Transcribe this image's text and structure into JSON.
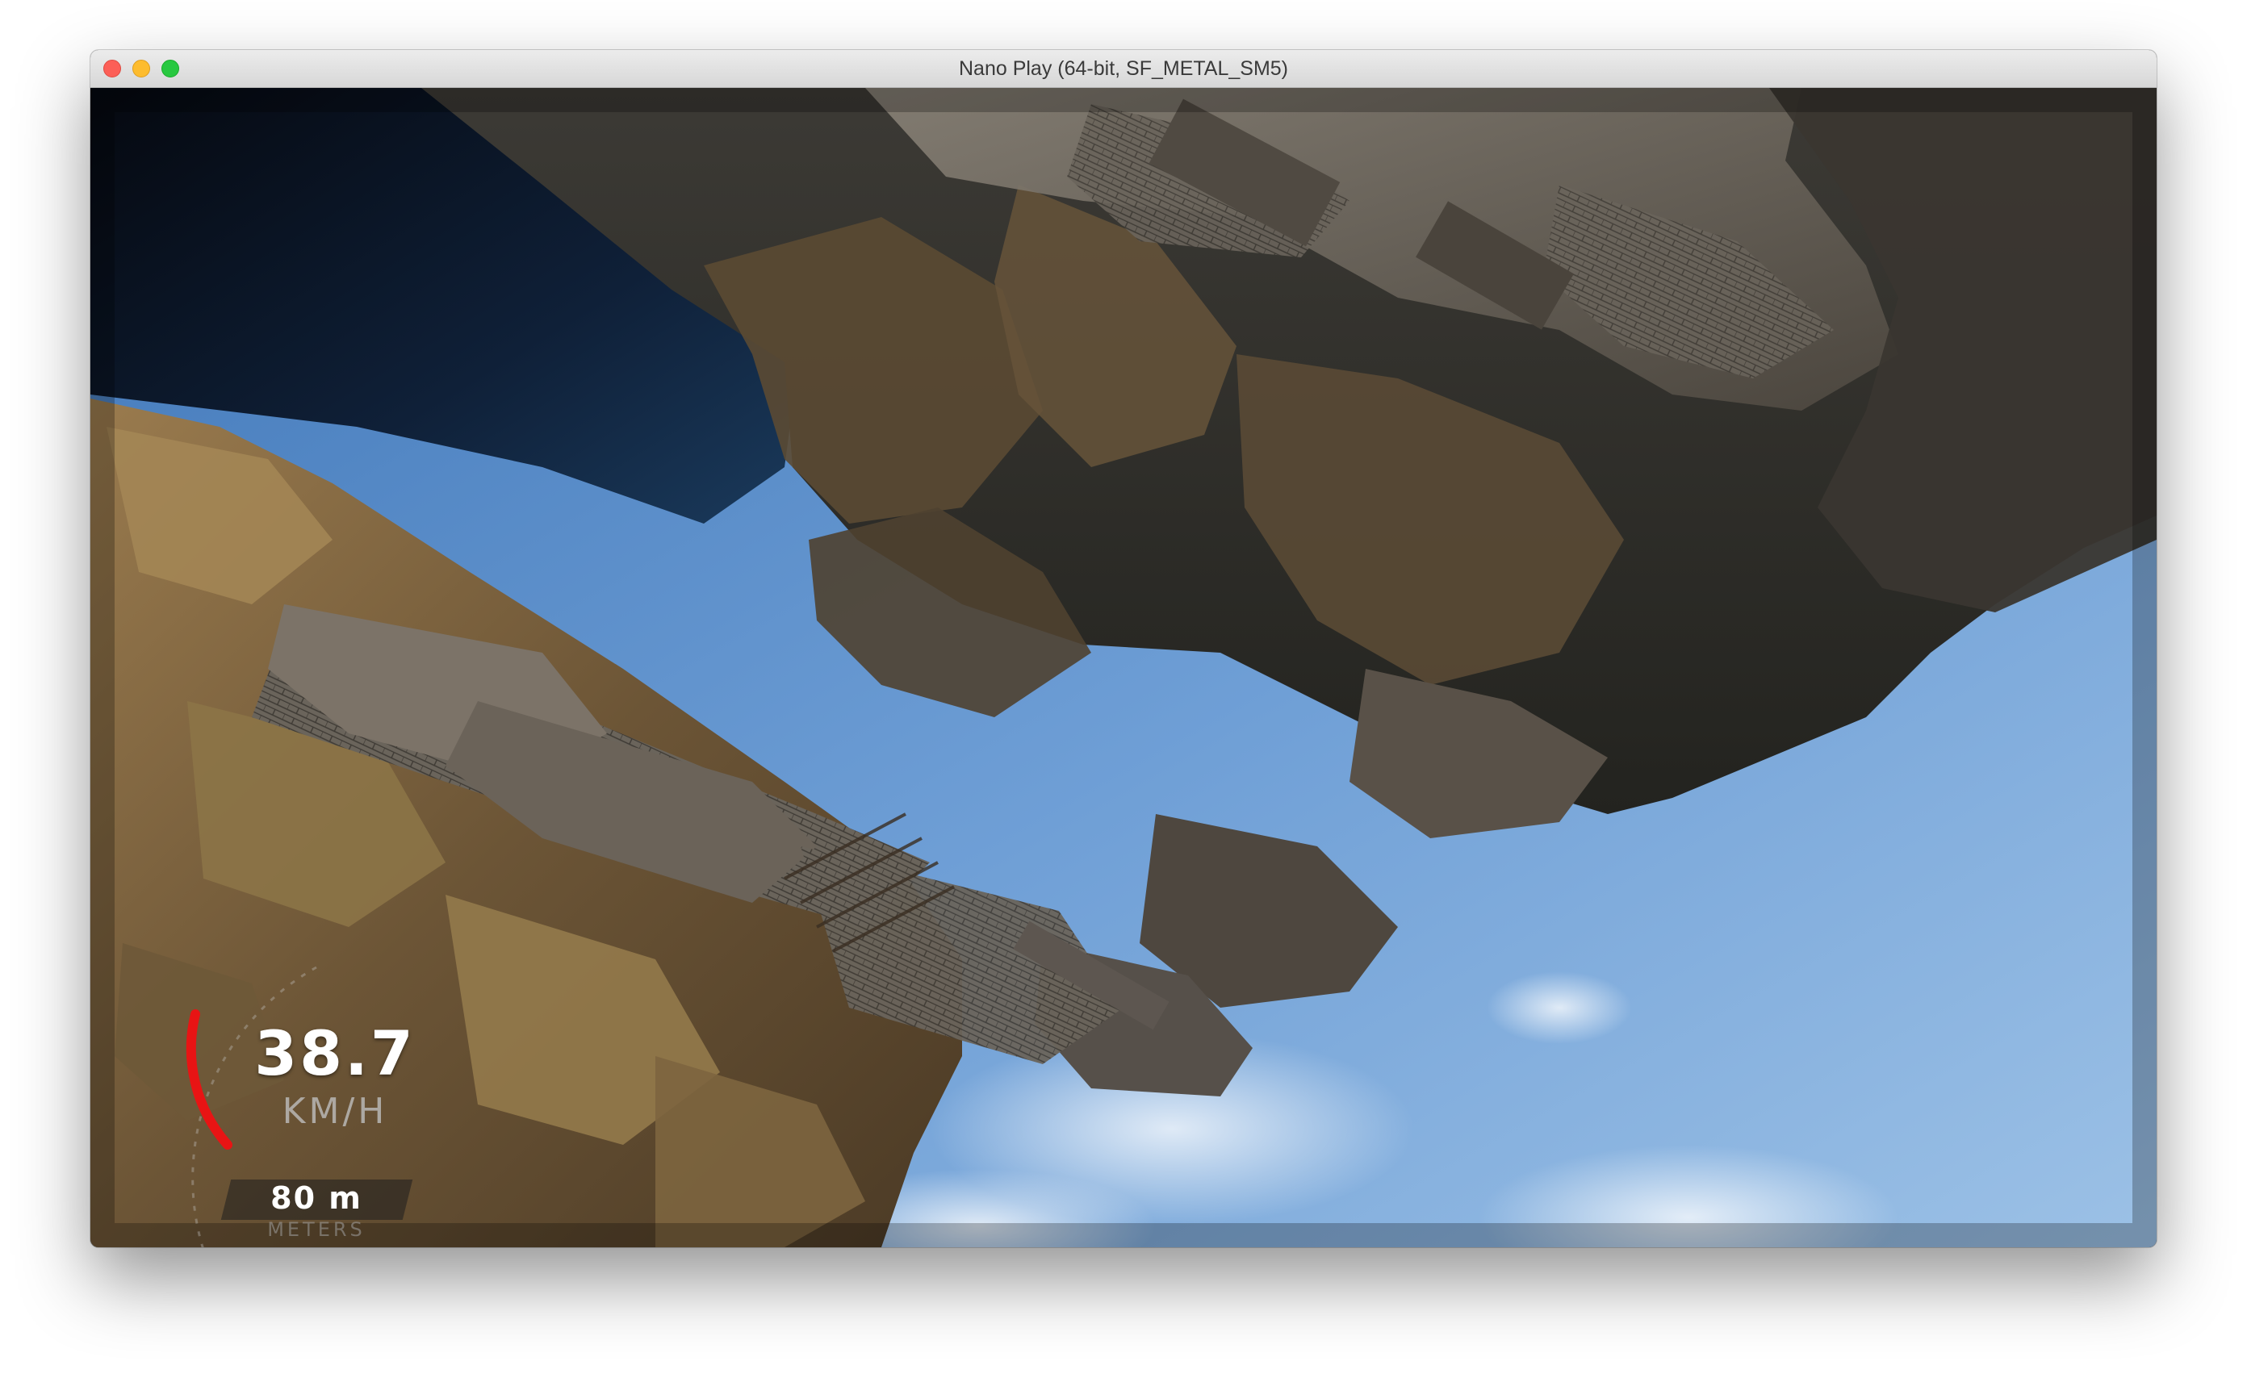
{
  "window": {
    "title": "Nano Play (64-bit, SF_METAL_SM5)"
  },
  "hud": {
    "speed_value": "38.7",
    "speed_unit": "KM/H",
    "altitude_value": "80 m",
    "altitude_caption": "METERS",
    "gauge_color": "#e81414"
  },
  "colors": {
    "sky": "#6f9fd6",
    "rock": "#7a6448",
    "stone": "#6e665c",
    "water": "#0d1b2e"
  }
}
